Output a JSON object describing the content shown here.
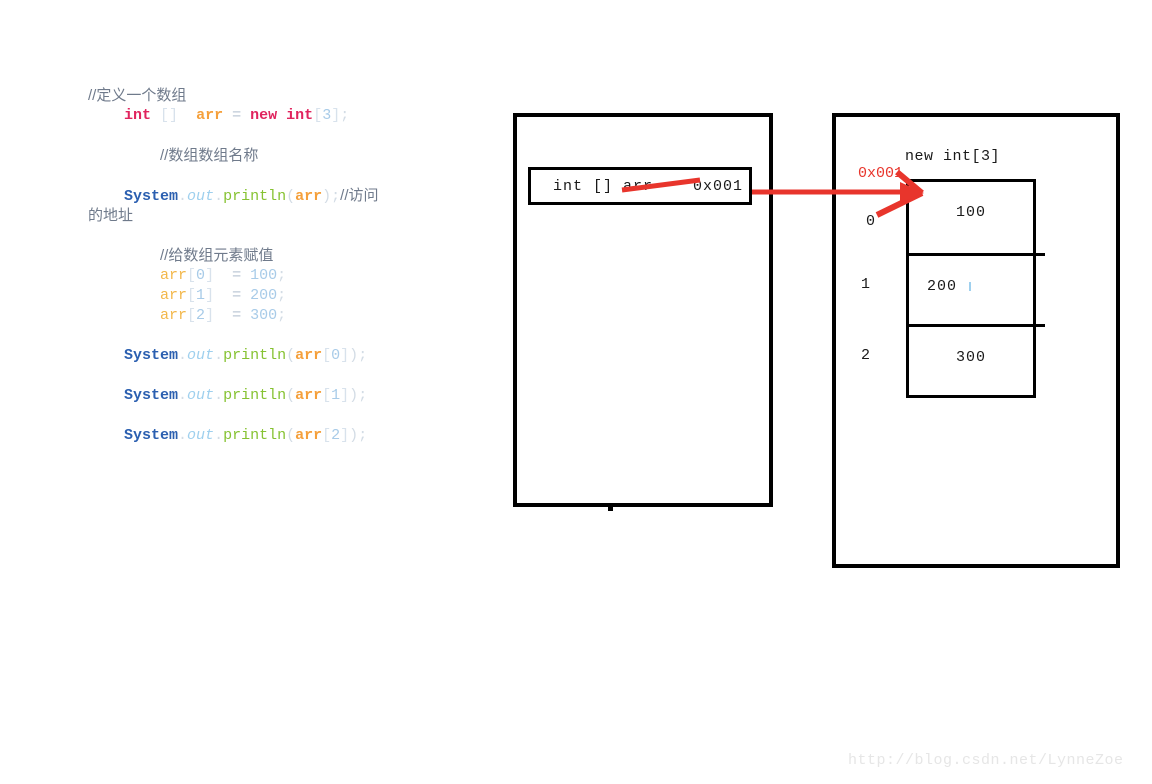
{
  "code": {
    "lines": [
      {
        "indent": 0,
        "tokens": [
          {
            "t": "comment",
            "s": "//定义一个数组"
          }
        ]
      },
      {
        "indent": 0,
        "tokens": [
          {
            "t": "pad",
            "s": "    "
          },
          {
            "t": "kw",
            "s": "int"
          },
          {
            "t": "plain",
            "s": " "
          },
          {
            "t": "brk",
            "s": "[]"
          },
          {
            "t": "plain",
            "s": "  "
          },
          {
            "t": "var",
            "s": "arr"
          },
          {
            "t": "plain",
            "s": " "
          },
          {
            "t": "op",
            "s": "="
          },
          {
            "t": "plain",
            "s": " "
          },
          {
            "t": "kw",
            "s": "new"
          },
          {
            "t": "plain",
            "s": " "
          },
          {
            "t": "kw",
            "s": "int"
          },
          {
            "t": "brk",
            "s": "["
          },
          {
            "t": "num",
            "s": "3"
          },
          {
            "t": "brk",
            "s": "]"
          },
          {
            "t": "semi",
            "s": ";"
          }
        ]
      },
      {
        "indent": 0,
        "tokens": []
      },
      {
        "indent": 0,
        "tokens": [
          {
            "t": "pad",
            "s": "        "
          },
          {
            "t": "comment",
            "s": "//数组数组名称"
          }
        ]
      },
      {
        "indent": 0,
        "tokens": []
      },
      {
        "indent": 0,
        "tokens": [
          {
            "t": "pad",
            "s": "    "
          },
          {
            "t": "class",
            "s": "System"
          },
          {
            "t": "semi",
            "s": "."
          },
          {
            "t": "field",
            "s": "out"
          },
          {
            "t": "semi",
            "s": "."
          },
          {
            "t": "method",
            "s": "println"
          },
          {
            "t": "paren",
            "s": "("
          },
          {
            "t": "var",
            "s": "arr"
          },
          {
            "t": "paren",
            "s": ")"
          },
          {
            "t": "semi",
            "s": ";"
          },
          {
            "t": "comment",
            "s": "//访问"
          }
        ]
      },
      {
        "indent": 0,
        "tokens": [
          {
            "t": "comment",
            "s": "的地址"
          }
        ]
      },
      {
        "indent": 0,
        "tokens": []
      },
      {
        "indent": 0,
        "tokens": [
          {
            "t": "pad",
            "s": "        "
          },
          {
            "t": "comment",
            "s": "//给数组元素赋值"
          }
        ]
      },
      {
        "indent": 0,
        "tokens": [
          {
            "t": "pad",
            "s": "        "
          },
          {
            "t": "var2",
            "s": "arr"
          },
          {
            "t": "brk",
            "s": "["
          },
          {
            "t": "num",
            "s": "0"
          },
          {
            "t": "brk",
            "s": "]"
          },
          {
            "t": "plain",
            "s": "  "
          },
          {
            "t": "op",
            "s": "="
          },
          {
            "t": "plain",
            "s": " "
          },
          {
            "t": "num",
            "s": "100"
          },
          {
            "t": "semi",
            "s": ";"
          }
        ]
      },
      {
        "indent": 0,
        "tokens": [
          {
            "t": "pad",
            "s": "        "
          },
          {
            "t": "var2",
            "s": "arr"
          },
          {
            "t": "brk",
            "s": "["
          },
          {
            "t": "num",
            "s": "1"
          },
          {
            "t": "brk",
            "s": "]"
          },
          {
            "t": "plain",
            "s": "  "
          },
          {
            "t": "op",
            "s": "="
          },
          {
            "t": "plain",
            "s": " "
          },
          {
            "t": "num",
            "s": "200"
          },
          {
            "t": "semi",
            "s": ";"
          }
        ]
      },
      {
        "indent": 0,
        "tokens": [
          {
            "t": "pad",
            "s": "        "
          },
          {
            "t": "var2",
            "s": "arr"
          },
          {
            "t": "brk",
            "s": "["
          },
          {
            "t": "num",
            "s": "2"
          },
          {
            "t": "brk",
            "s": "]"
          },
          {
            "t": "plain",
            "s": "  "
          },
          {
            "t": "op",
            "s": "="
          },
          {
            "t": "plain",
            "s": " "
          },
          {
            "t": "num",
            "s": "300"
          },
          {
            "t": "semi",
            "s": ";"
          }
        ]
      },
      {
        "indent": 0,
        "tokens": []
      },
      {
        "indent": 0,
        "tokens": [
          {
            "t": "pad",
            "s": "    "
          },
          {
            "t": "class",
            "s": "System"
          },
          {
            "t": "semi",
            "s": "."
          },
          {
            "t": "field",
            "s": "out"
          },
          {
            "t": "semi",
            "s": "."
          },
          {
            "t": "method",
            "s": "println"
          },
          {
            "t": "paren",
            "s": "("
          },
          {
            "t": "var",
            "s": "arr"
          },
          {
            "t": "brk",
            "s": "["
          },
          {
            "t": "num",
            "s": "0"
          },
          {
            "t": "brk",
            "s": "]"
          },
          {
            "t": "paren",
            "s": ")"
          },
          {
            "t": "semi",
            "s": ";"
          }
        ]
      },
      {
        "indent": 0,
        "tokens": []
      },
      {
        "indent": 0,
        "tokens": [
          {
            "t": "pad",
            "s": "    "
          },
          {
            "t": "class",
            "s": "System"
          },
          {
            "t": "semi",
            "s": "."
          },
          {
            "t": "field",
            "s": "out"
          },
          {
            "t": "semi",
            "s": "."
          },
          {
            "t": "method",
            "s": "println"
          },
          {
            "t": "paren",
            "s": "("
          },
          {
            "t": "var",
            "s": "arr"
          },
          {
            "t": "brk",
            "s": "["
          },
          {
            "t": "num",
            "s": "1"
          },
          {
            "t": "brk",
            "s": "]"
          },
          {
            "t": "paren",
            "s": ")"
          },
          {
            "t": "semi",
            "s": ";"
          }
        ]
      },
      {
        "indent": 0,
        "tokens": []
      },
      {
        "indent": 0,
        "tokens": [
          {
            "t": "pad",
            "s": "    "
          },
          {
            "t": "class",
            "s": "System"
          },
          {
            "t": "semi",
            "s": "."
          },
          {
            "t": "field",
            "s": "out"
          },
          {
            "t": "semi",
            "s": "."
          },
          {
            "t": "method",
            "s": "println"
          },
          {
            "t": "paren",
            "s": "("
          },
          {
            "t": "var",
            "s": "arr"
          },
          {
            "t": "brk",
            "s": "["
          },
          {
            "t": "num",
            "s": "2"
          },
          {
            "t": "brk",
            "s": "]"
          },
          {
            "t": "paren",
            "s": ")"
          },
          {
            "t": "semi",
            "s": ";"
          }
        ]
      }
    ]
  },
  "stack": {
    "variable_label": "int [] arr    0x001"
  },
  "heap": {
    "title": "new int[3]",
    "address_label": "0x001",
    "cells": [
      {
        "index": "0",
        "value": "100"
      },
      {
        "index": "1",
        "value": "200"
      },
      {
        "index": "2",
        "value": "300"
      }
    ]
  },
  "watermark": {
    "text": "http://blog.csdn.net/LynneZoe"
  },
  "colors": {
    "arrow": "#e8352c",
    "box_border": "#000000",
    "heap_address": "#e8352c",
    "background": "#ffffff",
    "watermark": "#e6e6e6"
  }
}
